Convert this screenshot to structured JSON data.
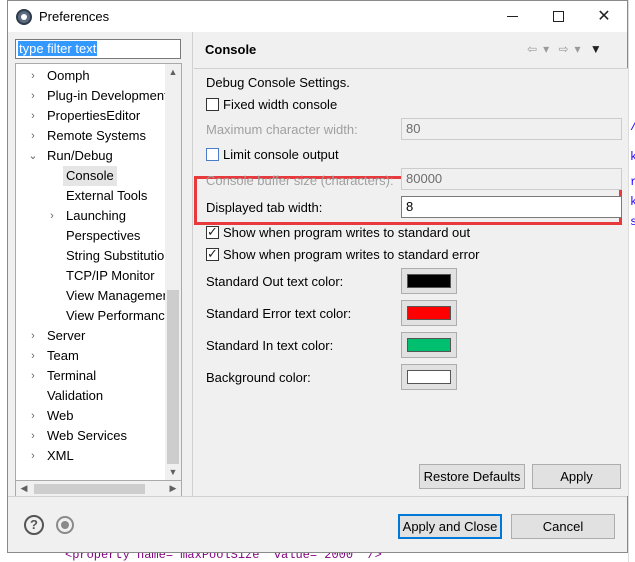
{
  "window": {
    "title": "Preferences"
  },
  "filter": {
    "value": "type filter text"
  },
  "tree": {
    "items": [
      {
        "label": "Oomph",
        "expander": "›",
        "selected": false
      },
      {
        "label": "Plug-in Development",
        "expander": "›",
        "selected": false
      },
      {
        "label": "PropertiesEditor",
        "expander": "›",
        "selected": false
      },
      {
        "label": "Remote Systems",
        "expander": "›",
        "selected": false
      },
      {
        "label": "Run/Debug",
        "expander": "⌄",
        "selected": false
      },
      {
        "label": "Console",
        "expander": "",
        "selected": true
      },
      {
        "label": "External Tools",
        "expander": "",
        "selected": false
      },
      {
        "label": "Launching",
        "expander": "›",
        "selected": false
      },
      {
        "label": "Perspectives",
        "expander": "",
        "selected": false
      },
      {
        "label": "String Substitution",
        "expander": "",
        "selected": false
      },
      {
        "label": "TCP/IP Monitor",
        "expander": "",
        "selected": false
      },
      {
        "label": "View Management",
        "expander": "",
        "selected": false
      },
      {
        "label": "View Performance",
        "expander": "",
        "selected": false
      },
      {
        "label": "Server",
        "expander": "›",
        "selected": false
      },
      {
        "label": "Team",
        "expander": "›",
        "selected": false
      },
      {
        "label": "Terminal",
        "expander": "›",
        "selected": false
      },
      {
        "label": "Validation",
        "expander": "",
        "selected": false
      },
      {
        "label": "Web",
        "expander": "›",
        "selected": false
      },
      {
        "label": "Web Services",
        "expander": "›",
        "selected": false
      },
      {
        "label": "XML",
        "expander": "›",
        "selected": false
      }
    ]
  },
  "page": {
    "title": "Console",
    "section_label": "Debug Console Settings.",
    "fixed_width": {
      "label": "Fixed width console",
      "checked": false
    },
    "max_char_width": {
      "label": "Maximum character width:",
      "value": "80"
    },
    "limit_output": {
      "label": "Limit console output",
      "checked": false
    },
    "buffer_size": {
      "label": "Console buffer size (characters):",
      "value": "80000"
    },
    "tab_width": {
      "label": "Displayed tab width:",
      "value": "8"
    },
    "show_stdout": {
      "label": "Show when program writes to standard out",
      "checked": true
    },
    "show_stderr": {
      "label": "Show when program writes to standard error",
      "checked": true
    },
    "colors": [
      {
        "label": "Standard Out text color:",
        "color": "#000000"
      },
      {
        "label": "Standard Error text color:",
        "color": "#ff0000"
      },
      {
        "label": "Standard In text color:",
        "color": "#00c070"
      },
      {
        "label": "Background color:",
        "color": "#ffffff"
      }
    ],
    "restore_defaults": "Restore Defaults",
    "apply": "Apply"
  },
  "footer": {
    "apply_close": "Apply and Close",
    "cancel": "Cancel"
  },
  "background": {
    "code_line": "<property name=\"maxPoolSize\" value=\"2000\" />"
  }
}
